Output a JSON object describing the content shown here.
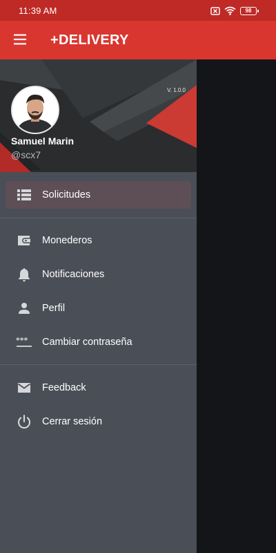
{
  "status_bar": {
    "time": "11:39 AM",
    "battery": "98",
    "icons": [
      "notification-off-icon",
      "wifi-icon",
      "battery-icon"
    ]
  },
  "app_bar": {
    "title": "+DELIVERY",
    "menu_icon": "hamburger-menu-icon"
  },
  "drawer": {
    "header": {
      "version": "V. 1.0.0",
      "user_name": "Samuel Marin",
      "user_handle": "@scx7"
    },
    "groups": [
      [
        {
          "label": "Solicitudes",
          "icon": "list-icon",
          "active": true
        }
      ],
      [
        {
          "label": "Monederos",
          "icon": "wallet-icon"
        },
        {
          "label": "Notificaciones",
          "icon": "bell-icon"
        },
        {
          "label": "Perfil",
          "icon": "person-icon"
        },
        {
          "label": "Cambiar contraseña",
          "icon": "password-icon"
        }
      ],
      [
        {
          "label": "Feedback",
          "icon": "mail-icon"
        },
        {
          "label": "Cerrar sesión",
          "icon": "power-icon"
        }
      ]
    ]
  },
  "colors": {
    "primary": "#d93630",
    "status_bar": "#bf2a26",
    "drawer_bg": "#4a4e57",
    "active_item_bg": "#5d4f55"
  }
}
